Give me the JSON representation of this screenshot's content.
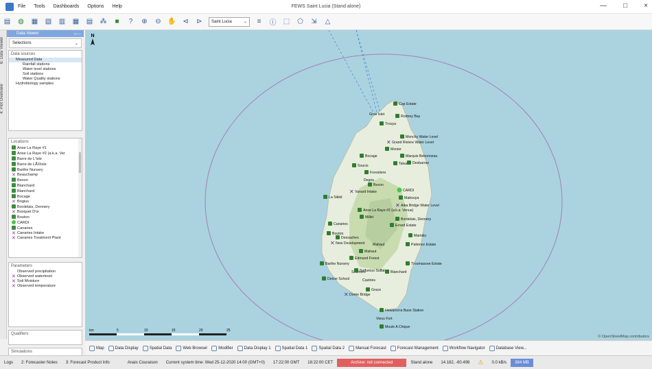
{
  "window": {
    "title": "FEWS Saint Lucia (Stand alone)",
    "minimize": "—",
    "maximize": "□",
    "close": "×"
  },
  "menu": [
    "File",
    "Tools",
    "Dashboards",
    "Options",
    "Help"
  ],
  "toolbar": {
    "location_combo": "Saint Lucia"
  },
  "side_tabs": {
    "data_viewer": "6: Data Viewer",
    "plot_overview": "4: Plot Overview"
  },
  "data_viewer": {
    "title": "Data Viewer",
    "selection": "Selections"
  },
  "data_sources": {
    "title": "Data sources",
    "items": [
      {
        "label": "Measured Data",
        "level": 1,
        "selected": true
      },
      {
        "label": "Rainfall stations",
        "level": 2
      },
      {
        "label": "Water level stations",
        "level": 2
      },
      {
        "label": "Soil stations",
        "level": 2
      },
      {
        "label": "Water Quality stations",
        "level": 2
      },
      {
        "label": "Hydrobiology samples",
        "level": 1
      }
    ]
  },
  "locations": {
    "title": "Locations",
    "items": [
      {
        "label": "Anse La Raye #1",
        "icon": "g"
      },
      {
        "label": "Anse La Raye #2 (a.k.a. Ver",
        "icon": "g"
      },
      {
        "label": "Barre de L'Isle",
        "icon": "g"
      },
      {
        "label": "Barre de LÃ©Isle",
        "icon": "g"
      },
      {
        "label": "Barthe Nursery",
        "icon": "g"
      },
      {
        "label": "Beauchamp",
        "icon": "x"
      },
      {
        "label": "Bexon",
        "icon": "g"
      },
      {
        "label": "Blanchard",
        "icon": "g"
      },
      {
        "label": "Blanchard",
        "icon": "g"
      },
      {
        "label": "Bocage",
        "icon": "g"
      },
      {
        "label": "Bogius",
        "icon": "x"
      },
      {
        "label": "Bordelais, Dennery",
        "icon": "g"
      },
      {
        "label": "Bosquet D'or",
        "icon": "x"
      },
      {
        "label": "Bouton",
        "icon": "g"
      },
      {
        "label": "CARDI",
        "icon": "c"
      },
      {
        "label": "Canaries",
        "icon": "g"
      },
      {
        "label": "Canaries Intake",
        "icon": "x"
      },
      {
        "label": "Canaries Treatment Plant",
        "icon": "x"
      }
    ]
  },
  "parameters": {
    "title": "Parameters",
    "items": [
      {
        "label": "Observed precipitation",
        "icon": ""
      },
      {
        "label": "Observed waterlevel",
        "icon": "x"
      },
      {
        "label": "Soil Moisture",
        "icon": "x"
      },
      {
        "label": "Observed temperature",
        "icon": "x"
      }
    ]
  },
  "qualifiers": {
    "title": "Qualifiers"
  },
  "simulations": {
    "title": "Simulations"
  },
  "map": {
    "north": "N",
    "attribution": "© OpenStreetMap contributors",
    "scale_labels": [
      "km",
      "5",
      "10",
      "15",
      "20",
      "25"
    ],
    "stations": [
      {
        "label": "Cap Estate",
        "icon": "g"
      },
      {
        "label": "Gros Islet",
        "icon": "none"
      },
      {
        "label": "Rodney Bay",
        "icon": "g"
      },
      {
        "label": "Trouya",
        "icon": "g"
      },
      {
        "label": "Monchy Water Level",
        "icon": "g"
      },
      {
        "label": "Grand Riviere Water Level",
        "icon": "x"
      },
      {
        "label": "Monier",
        "icon": "g"
      },
      {
        "label": "Marquis Bebonneau",
        "icon": "g"
      },
      {
        "label": "Bocage",
        "icon": "g"
      },
      {
        "label": "Talvan",
        "icon": "g"
      },
      {
        "label": "Desbarras",
        "icon": "g"
      },
      {
        "label": "Soucis",
        "icon": "g"
      },
      {
        "label": "Forestiere",
        "icon": "g"
      },
      {
        "label": "Degos",
        "icon": "none"
      },
      {
        "label": "Bexon",
        "icon": "g"
      },
      {
        "label": "CARDI",
        "icon": "c"
      },
      {
        "label": "Vanard Intake",
        "icon": "x"
      },
      {
        "label": "La Sikkit",
        "icon": "g"
      },
      {
        "label": "Mabouya",
        "icon": "g"
      },
      {
        "label": "Aiba Bridge Water Level",
        "icon": "x"
      },
      {
        "label": "Anse La Raye #2 (a.k.a. Venus)",
        "icon": "g"
      },
      {
        "label": "Millet",
        "icon": "g"
      },
      {
        "label": "Bordelais, Dennery",
        "icon": "g"
      },
      {
        "label": "Errard Estate",
        "icon": "g"
      },
      {
        "label": "Canaries",
        "icon": "g"
      },
      {
        "label": "Bouton",
        "icon": "g"
      },
      {
        "label": "Dessaches",
        "icon": "g"
      },
      {
        "label": "Mamiku",
        "icon": "g"
      },
      {
        "label": "New Development",
        "icon": "x"
      },
      {
        "label": "Mahaut",
        "icon": "none"
      },
      {
        "label": "Patience Estate",
        "icon": "g"
      },
      {
        "label": "Mahaut",
        "icon": "g"
      },
      {
        "label": "Edmund Forest",
        "icon": "g"
      },
      {
        "label": "Barthe Nursery",
        "icon": "g"
      },
      {
        "label": "Troumassee Estate",
        "icon": "g"
      },
      {
        "label": "Soufriere",
        "icon": "none"
      },
      {
        "label": "Sulfurous Sulfate",
        "icon": "g"
      },
      {
        "label": "Blanchard",
        "icon": "g"
      },
      {
        "label": "Delcer School",
        "icon": "g"
      },
      {
        "label": "Castries",
        "icon": "none"
      },
      {
        "label": "Grace",
        "icon": "g"
      },
      {
        "label": "Dorée Bridge",
        "icon": "x"
      },
      {
        "label": "Hewanorra Base Station",
        "icon": "g"
      },
      {
        "label": "Vieux Fort",
        "icon": "none"
      },
      {
        "label": "Moule A Chique",
        "icon": "g"
      }
    ]
  },
  "bottom_tabs": [
    "Map",
    "Data Display",
    "Spatial Data",
    "Web Browser",
    "Modifier",
    "Data Display 1",
    "Spatial Data 1",
    "Spatial Data 2",
    "Manual Forecast",
    "Forecast Management",
    "Workflow Navigator",
    "Database View..."
  ],
  "status": {
    "logs": "Logs",
    "notes": "2: Forecaster Notes",
    "product_info": "3: Forecast Product Info",
    "user": "Anais Couraison",
    "system_time": "Current system time: Wed 25-12-2020 14:00 (GMT+0)",
    "gmt": "17:22:00 GMT",
    "cet": "18:22:00 CET",
    "archive": "Archive: not connected",
    "mode": "Stand alone",
    "coords": "14.182, -60.498",
    "rate": "0.0 kB/s",
    "memory": "384 MB"
  }
}
